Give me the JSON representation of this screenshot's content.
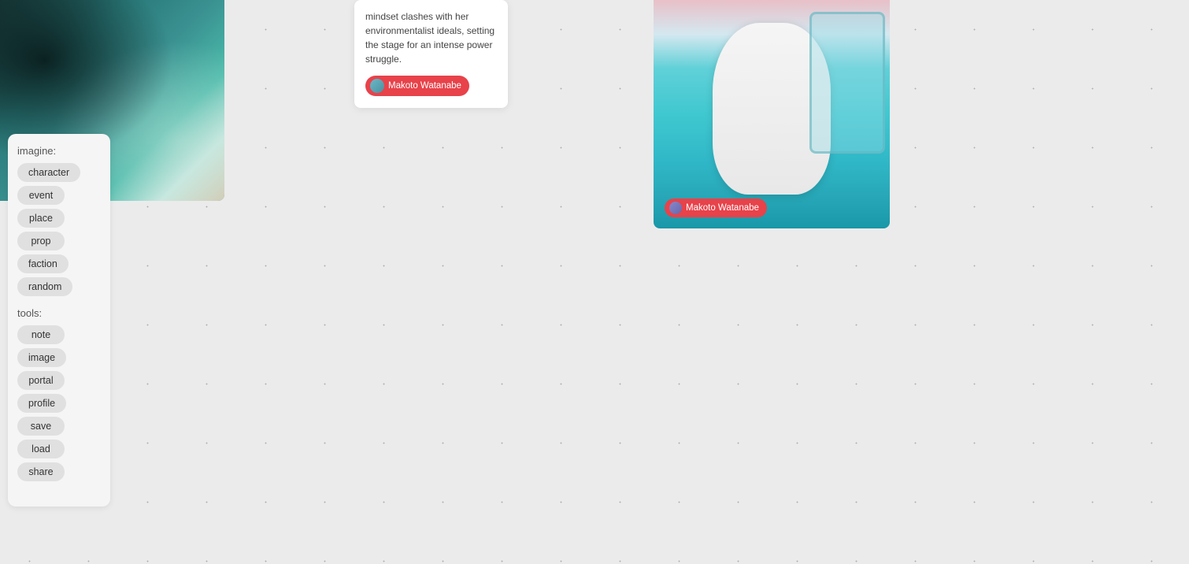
{
  "sidebar": {
    "imagine_label": "imagine:",
    "imagine_buttons": [
      {
        "id": "character",
        "label": "character"
      },
      {
        "id": "event",
        "label": "event"
      },
      {
        "id": "place",
        "label": "place"
      },
      {
        "id": "prop",
        "label": "prop"
      },
      {
        "id": "faction",
        "label": "faction"
      },
      {
        "id": "random",
        "label": "random"
      }
    ],
    "tools_label": "tools:",
    "tools_buttons": [
      {
        "id": "note",
        "label": "note"
      },
      {
        "id": "image",
        "label": "image"
      },
      {
        "id": "portal",
        "label": "portal"
      },
      {
        "id": "profile",
        "label": "profile"
      },
      {
        "id": "save",
        "label": "save"
      },
      {
        "id": "load",
        "label": "load"
      },
      {
        "id": "share",
        "label": "share"
      }
    ]
  },
  "cards": {
    "text_card": {
      "body": "mindset clashes with her environmentalist ideals, setting the stage for an intense power struggle.",
      "tag_name": "Makoto Watanabe"
    },
    "character_card": {
      "tag_name": "Makoto Watanabe"
    }
  }
}
